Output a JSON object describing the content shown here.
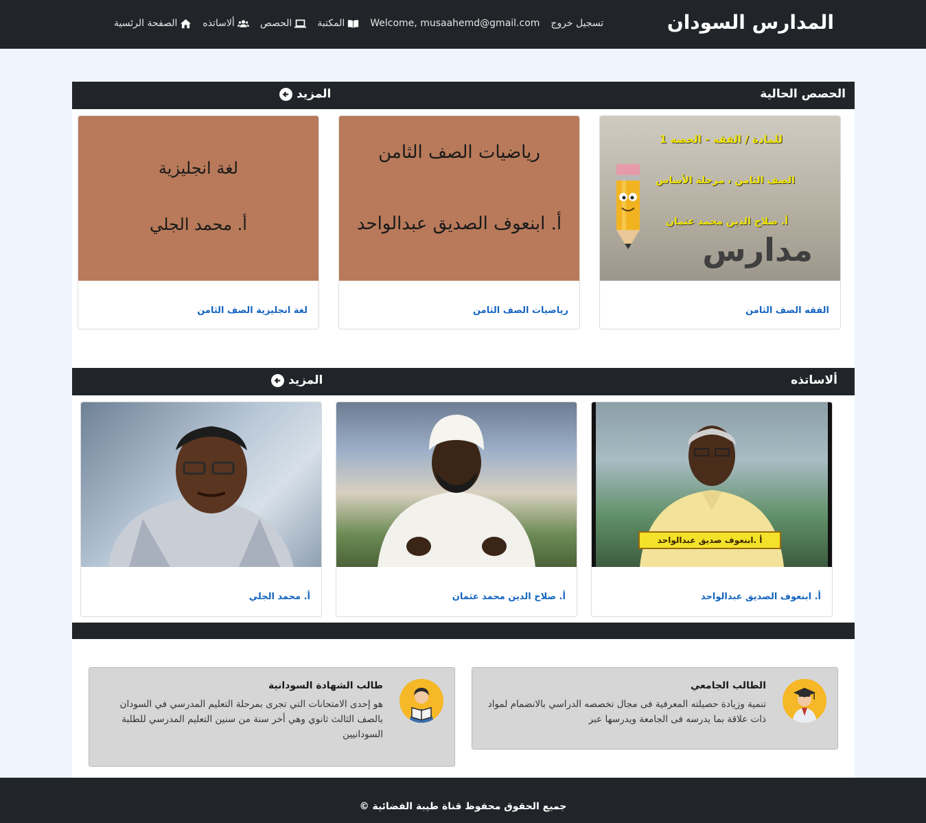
{
  "navbar": {
    "brand": "المدارس السودان",
    "links": {
      "home": "الصفحة الرئسية",
      "teachers": "ألاساتذه",
      "lessons": "الحصص",
      "library": "المكتبة",
      "welcome": "Welcome, musaahemd@gmail.com",
      "logout": "تسجيل خروج"
    }
  },
  "lessons_section": {
    "title": "الحصص الحالية",
    "more": "المزيد",
    "cards": [
      {
        "title": "الفقه الصف الثامن",
        "thumb_lines": [
          "للمادة / الفقه - الحصه 1",
          "الصف الثامن ، مرحلة الأساس",
          "أ. صلاح الدين محمد عثمان"
        ],
        "thumb_logo": "مدارس"
      },
      {
        "title": "رياضيات الصف الثامن",
        "thumb_lines": [
          "رياضيات الصف الثامن",
          "أ. ابنعوف الصديق عبدالواحد"
        ]
      },
      {
        "title": "لغة انجليزية الصف الثامن",
        "thumb_lines": [
          "لغة انجليزية",
          "أ. محمد الجلي"
        ]
      }
    ]
  },
  "teachers_section": {
    "title": "ألاساتذه",
    "more": "المزيد",
    "cards": [
      {
        "name": "أ. ابنعوف الصديق عبدالواحد",
        "caption": "أ .ابنعوف صديق عبدالواحد"
      },
      {
        "name": "أ. صلاح الدين محمد عثمان"
      },
      {
        "name": "أ. محمد الجلي"
      }
    ]
  },
  "features": [
    {
      "title": "الطالب الجامعي",
      "desc": "تنمية وزيادة حصيلته المعرفية فى مجال تخصصه الدراسي بالانضمام لمواد ذات علاقة بما يدرسه فى الجامعة ويدرسها عبر"
    },
    {
      "title": "طالب الشهادة السودانية",
      "desc": "هو إحدى الامتحانات التي تجرى بمرحلة التعليم المدرسي في السودان بالصف الثالث ثانوي وهي أخر سنة من سنين التعليم المدرسي للطلبة السودانيين"
    }
  ],
  "footer": {
    "copyright": "جميع الحقوق محفوظ قناة طيبة الفضائية ©"
  },
  "colors": {
    "navbar": "#212529",
    "link": "#1565c0",
    "thumb_brown": "#b87a5a",
    "avatar": "#f6b826"
  }
}
